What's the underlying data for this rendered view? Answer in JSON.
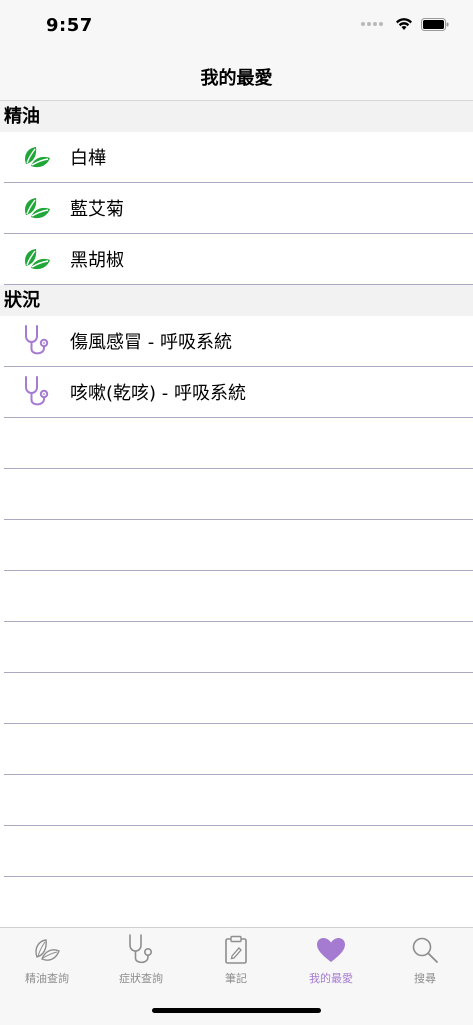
{
  "status_bar": {
    "time": "9:57",
    "icons": [
      "signal-dots-icon",
      "wifi-icon",
      "battery-icon"
    ]
  },
  "nav": {
    "title": "我的最愛"
  },
  "sections": [
    {
      "header": "精油",
      "icon": "leaf-icon",
      "items": [
        "白樺",
        "藍艾菊",
        "黑胡椒"
      ]
    },
    {
      "header": "狀況",
      "icon": "stethoscope-icon",
      "items": [
        "傷風感冒 - 呼吸系統",
        "咳嗽(乾咳) - 呼吸系統"
      ]
    }
  ],
  "tabs": [
    {
      "label": "精油查詢",
      "icon": "leaf-outline-icon",
      "active": false
    },
    {
      "label": "症狀查詢",
      "icon": "stethoscope-icon",
      "active": false
    },
    {
      "label": "筆記",
      "icon": "clipboard-icon",
      "active": false
    },
    {
      "label": "我的最愛",
      "icon": "heart-icon",
      "active": true
    },
    {
      "label": "搜尋",
      "icon": "search-icon",
      "active": false
    }
  ],
  "colors": {
    "leaf": "#21a63a",
    "accent": "#a57bd1",
    "separator": "#a9a9c2",
    "inactive": "#8e8e8e"
  }
}
